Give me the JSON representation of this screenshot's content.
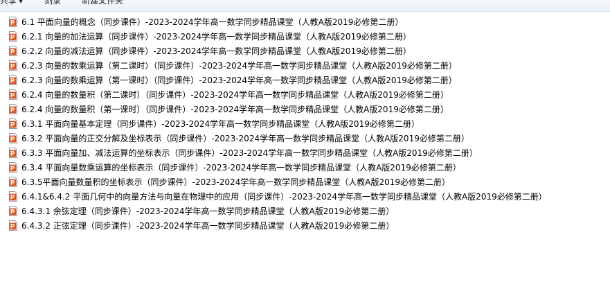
{
  "toolbar": {
    "share_label": "共享",
    "burn_label": "刻录",
    "new_folder_label": "新建文件夹"
  },
  "colors": {
    "ppt_icon_fill": "#e5622a",
    "ppt_icon_border": "#b8431a",
    "toolbar_bg": "#eef3f9"
  },
  "file_icon": "powerpoint-file-icon",
  "files": [
    {
      "name": "6.1 平面向量的概念（同步课件）-2023-2024学年高一数学同步精品课堂（人教A版2019必修第二册）"
    },
    {
      "name": "6.2.1 向量的加法运算（同步课件）-2023-2024学年高一数学同步精品课堂（人教A版2019必修第二册）"
    },
    {
      "name": "6.2.2 向量的减法运算（同步课件）-2023-2024学年高一数学同步精品课堂（人教A版2019必修第二册）"
    },
    {
      "name": "6.2.3 向量的数乘运算（第二课时）（同步课件）-2023-2024学年高一数学同步精品课堂（人教A版2019必修第二册）"
    },
    {
      "name": "6.2.3 向量的数乘运算（第一课时）（同步课件）-2023-2024学年高一数学同步精品课堂（人教A版2019必修第二册）"
    },
    {
      "name": "6.2.4 向量的数量积（第二课时）（同步课件）-2023-2024学年高一数学同步精品课堂（人教A版2019必修第二册）"
    },
    {
      "name": "6.2.4 向量的数量积（第一课时）（同步课件）-2023-2024学年高一数学同步精品课堂（人教A版2019必修第二册）"
    },
    {
      "name": "6.3.1 平面向量基本定理（同步课件）-2023-2024学年高一数学同步精品课堂（人教A版2019必修第二册）"
    },
    {
      "name": "6.3.2 平面向量的正交分解及坐标表示（同步课件）-2023-2024学年高一数学同步精品课堂（人教A版2019必修第二册）"
    },
    {
      "name": "6.3.3 平面向量加、减法运算的坐标表示（同步课件）-2023-2024学年高一数学同步精品课堂（人教A版2019必修第二册）"
    },
    {
      "name": "6.3.4 平面向量数乘运算的坐标表示（同步课件）-2023-2024学年高一数学同步精品课堂（人教A版2019必修第二册）"
    },
    {
      "name": "6.3.5平面向量数量积的坐标表示（同步课件）-2023-2024学年高一数学同步精品课堂（人教A版2019必修第二册）"
    },
    {
      "name": "6.4.1&6.4.2 平面几何中的向量方法与向量在物理中的应用（同步课件）-2023-2024学年高一数学同步精品课堂（人教A版2019必修第二册）"
    },
    {
      "name": "6.4.3.1 余弦定理（同步课件）-2023-2024学年高一数学同步精品课堂（人教A版2019必修第二册）"
    },
    {
      "name": "6.4.3.2 正弦定理（同步课件）-2023-2024学年高一数学同步精品课堂（人教A版2019必修第二册）"
    }
  ]
}
